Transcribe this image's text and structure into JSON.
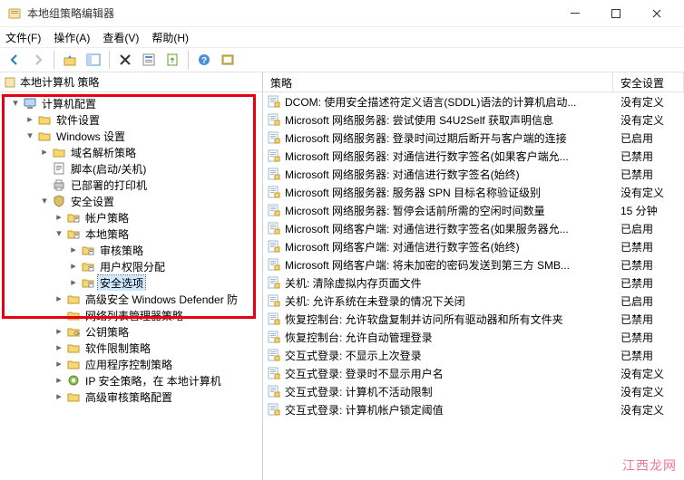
{
  "window": {
    "title": "本地组策略编辑器",
    "menu": {
      "file": "文件(F)",
      "action": "操作(A)",
      "view": "查看(V)",
      "help": "帮助(H)"
    },
    "root_node": "本地计算机 策略"
  },
  "tree": [
    {
      "depth": 0,
      "toggle": "▾",
      "icon": "computer",
      "label": "计算机配置"
    },
    {
      "depth": 1,
      "toggle": ">",
      "icon": "folder",
      "label": "软件设置"
    },
    {
      "depth": 1,
      "toggle": "▾",
      "icon": "folder",
      "label": "Windows 设置"
    },
    {
      "depth": 2,
      "toggle": ">",
      "icon": "folder",
      "label": "域名解析策略"
    },
    {
      "depth": 2,
      "toggle": "",
      "icon": "script",
      "label": "脚本(启动/关机)"
    },
    {
      "depth": 2,
      "toggle": "",
      "icon": "printer",
      "label": "已部署的打印机"
    },
    {
      "depth": 2,
      "toggle": "▾",
      "icon": "shield",
      "label": "安全设置"
    },
    {
      "depth": 3,
      "toggle": ">",
      "icon": "folder-s",
      "label": "帐户策略"
    },
    {
      "depth": 3,
      "toggle": "▾",
      "icon": "folder-s",
      "label": "本地策略"
    },
    {
      "depth": 4,
      "toggle": ">",
      "icon": "folder-s",
      "label": "审核策略"
    },
    {
      "depth": 4,
      "toggle": ">",
      "icon": "folder-s",
      "label": "用户权限分配"
    },
    {
      "depth": 4,
      "toggle": ">",
      "icon": "folder-s",
      "label": "安全选项",
      "selected": true
    },
    {
      "depth": 3,
      "toggle": ">",
      "icon": "folder",
      "label": "高级安全 Windows Defender 防"
    },
    {
      "depth": 3,
      "toggle": "",
      "icon": "folder",
      "label": "网络列表管理器策略"
    },
    {
      "depth": 3,
      "toggle": ">",
      "icon": "folder-key",
      "label": "公钥策略"
    },
    {
      "depth": 3,
      "toggle": ">",
      "icon": "folder",
      "label": "软件限制策略"
    },
    {
      "depth": 3,
      "toggle": ">",
      "icon": "folder",
      "label": "应用程序控制策略"
    },
    {
      "depth": 3,
      "toggle": ">",
      "icon": "ipsec",
      "label": "IP 安全策略，在 本地计算机"
    },
    {
      "depth": 3,
      "toggle": ">",
      "icon": "folder",
      "label": "高级审核策略配置"
    }
  ],
  "list_header": {
    "c1": "策略",
    "c2": "安全设置"
  },
  "policies": [
    {
      "t": "DCOM: 使用安全描述符定义语言(SDDL)语法的计算机启动...",
      "v": "没有定义"
    },
    {
      "t": "Microsoft 网络服务器: 尝试使用 S4U2Self 获取声明信息",
      "v": "没有定义"
    },
    {
      "t": "Microsoft 网络服务器: 登录时间过期后断开与客户端的连接",
      "v": "已启用"
    },
    {
      "t": "Microsoft 网络服务器: 对通信进行数字签名(如果客户端允...",
      "v": "已禁用"
    },
    {
      "t": "Microsoft 网络服务器: 对通信进行数字签名(始终)",
      "v": "已禁用"
    },
    {
      "t": "Microsoft 网络服务器: 服务器 SPN 目标名称验证级别",
      "v": "没有定义"
    },
    {
      "t": "Microsoft 网络服务器: 暂停会话前所需的空闲时间数量",
      "v": "15 分钟"
    },
    {
      "t": "Microsoft 网络客户端: 对通信进行数字签名(如果服务器允...",
      "v": "已启用"
    },
    {
      "t": "Microsoft 网络客户端: 对通信进行数字签名(始终)",
      "v": "已禁用"
    },
    {
      "t": "Microsoft 网络客户端: 将未加密的密码发送到第三方 SMB...",
      "v": "已禁用"
    },
    {
      "t": "关机: 清除虚拟内存页面文件",
      "v": "已禁用"
    },
    {
      "t": "关机: 允许系统在未登录的情况下关闭",
      "v": "已启用"
    },
    {
      "t": "恢复控制台: 允许软盘复制并访问所有驱动器和所有文件夹",
      "v": "已禁用"
    },
    {
      "t": "恢复控制台: 允许自动管理登录",
      "v": "已禁用"
    },
    {
      "t": "交互式登录: 不显示上次登录",
      "v": "已禁用"
    },
    {
      "t": "交互式登录: 登录时不显示用户名",
      "v": "没有定义"
    },
    {
      "t": "交互式登录: 计算机不活动限制",
      "v": "没有定义"
    },
    {
      "t": "交互式登录: 计算机帐户锁定阈值",
      "v": "没有定义"
    }
  ],
  "watermark": "江西龙网"
}
